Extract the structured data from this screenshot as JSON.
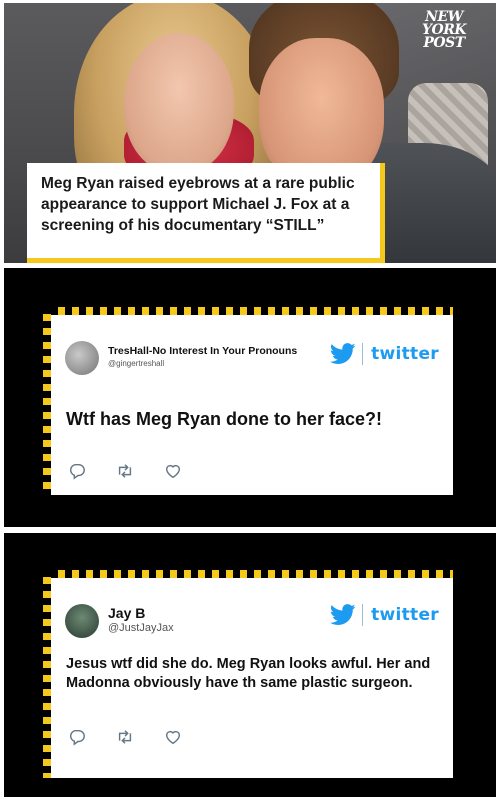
{
  "header_image": {
    "logo_lines": [
      "NEW",
      "YORK",
      "POST"
    ],
    "caption": "Meg Ryan raised eyebrows at a rare public appearance to support Michael J. Fox at a screening of his documentary “STILL”",
    "accent_color": "#f4c91b"
  },
  "tweets": [
    {
      "display_name": "TresHall-No Interest In Your Pronouns",
      "handle": "@gingertreshall",
      "text": "Wtf has Meg Ryan done to her face?!",
      "brand_label": "twitter",
      "brand_icon": "twitter-bird-icon",
      "actions": [
        "reply-icon",
        "retweet-icon",
        "like-icon"
      ]
    },
    {
      "display_name": "Jay B",
      "handle": "@JustJayJax",
      "text": "Jesus wtf did she do. Meg Ryan looks awful. Her and Madonna obviously have th same plastic surgeon.",
      "brand_label": "twitter",
      "brand_icon": "twitter-bird-icon",
      "actions": [
        "reply-icon",
        "retweet-icon",
        "like-icon"
      ]
    }
  ],
  "colors": {
    "twitter_blue": "#1d9bf0",
    "panel_background": "#000000",
    "hazard_stripe": "#f4c91b"
  }
}
